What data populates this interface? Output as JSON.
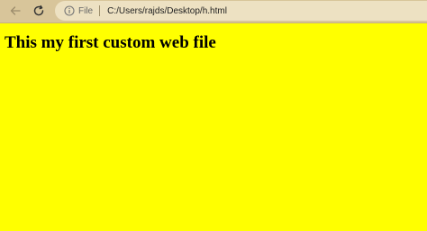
{
  "browser": {
    "nav": {
      "back_icon": "arrow-left-icon",
      "reload_icon": "reload-icon"
    },
    "address_bar": {
      "info_icon": "info-circle-icon",
      "scheme_label": "File",
      "url": "C:/Users/rajds/Desktop/h.html"
    }
  },
  "page": {
    "heading": "This my first custom web file",
    "background_color": "#ffff00"
  }
}
